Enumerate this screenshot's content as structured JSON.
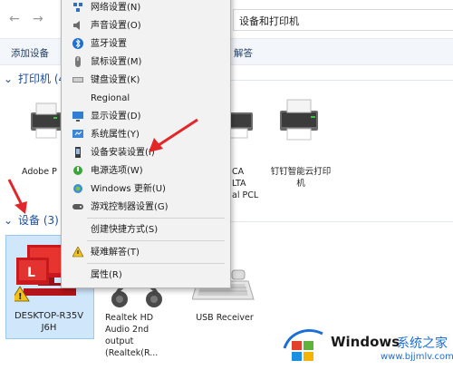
{
  "address": {
    "path": "设备和打印机"
  },
  "commandbar": {
    "add_device": "添加设备",
    "troubleshoot": "解答"
  },
  "printers": {
    "header": "打印机 (4",
    "items": [
      {
        "label": "Adobe P"
      },
      {
        "label_1": "CA",
        "label_2": "LTA",
        "label_3": "al PCL"
      },
      {
        "label": "钉钉智能云打印机"
      }
    ]
  },
  "devices": {
    "header": "设备 (3)",
    "items": [
      {
        "label_1": "DESKTOP-R35V",
        "label_2": "J6H"
      },
      {
        "label_1": "Realtek HD",
        "label_2": "Audio 2nd",
        "label_3": "output",
        "label_4": "(Realtek(R..."
      },
      {
        "label": "USB Receiver"
      }
    ]
  },
  "context_menu": {
    "items": [
      {
        "label": "网络设置(N)",
        "icon": "network-icon"
      },
      {
        "label": "声音设置(O)",
        "icon": "speaker-icon"
      },
      {
        "label": "蓝牙设置",
        "icon": "bluetooth-icon"
      },
      {
        "label": "鼠标设置(M)",
        "icon": "mouse-icon"
      },
      {
        "label": "键盘设置(K)",
        "icon": "keyboard-icon"
      },
      {
        "label": "Regional",
        "icon": ""
      },
      {
        "label": "显示设置(D)",
        "icon": "display-icon"
      },
      {
        "label": "系统属性(Y)",
        "icon": "system-icon"
      },
      {
        "label": "设备安装设置(I)",
        "icon": "device-install-icon"
      },
      {
        "label": "电源选项(W)",
        "icon": "power-icon"
      },
      {
        "label": "Windows 更新(U)",
        "icon": "windows-update-icon"
      },
      {
        "label": "游戏控制器设置(G)",
        "icon": "gamepad-icon"
      },
      {
        "label": "创建快捷方式(S)",
        "icon": ""
      },
      {
        "label": "疑难解答(T)",
        "icon": "warning-icon"
      },
      {
        "label": "属性(R)",
        "icon": ""
      }
    ]
  },
  "watermark": {
    "brand": "Windows",
    "cn": "系统之家",
    "url": "www.bjjmlv.com"
  },
  "colors": {
    "accent_red": "#e3262a",
    "link_blue": "#1e4e9a",
    "menu_bg": "#f2f2f2"
  }
}
